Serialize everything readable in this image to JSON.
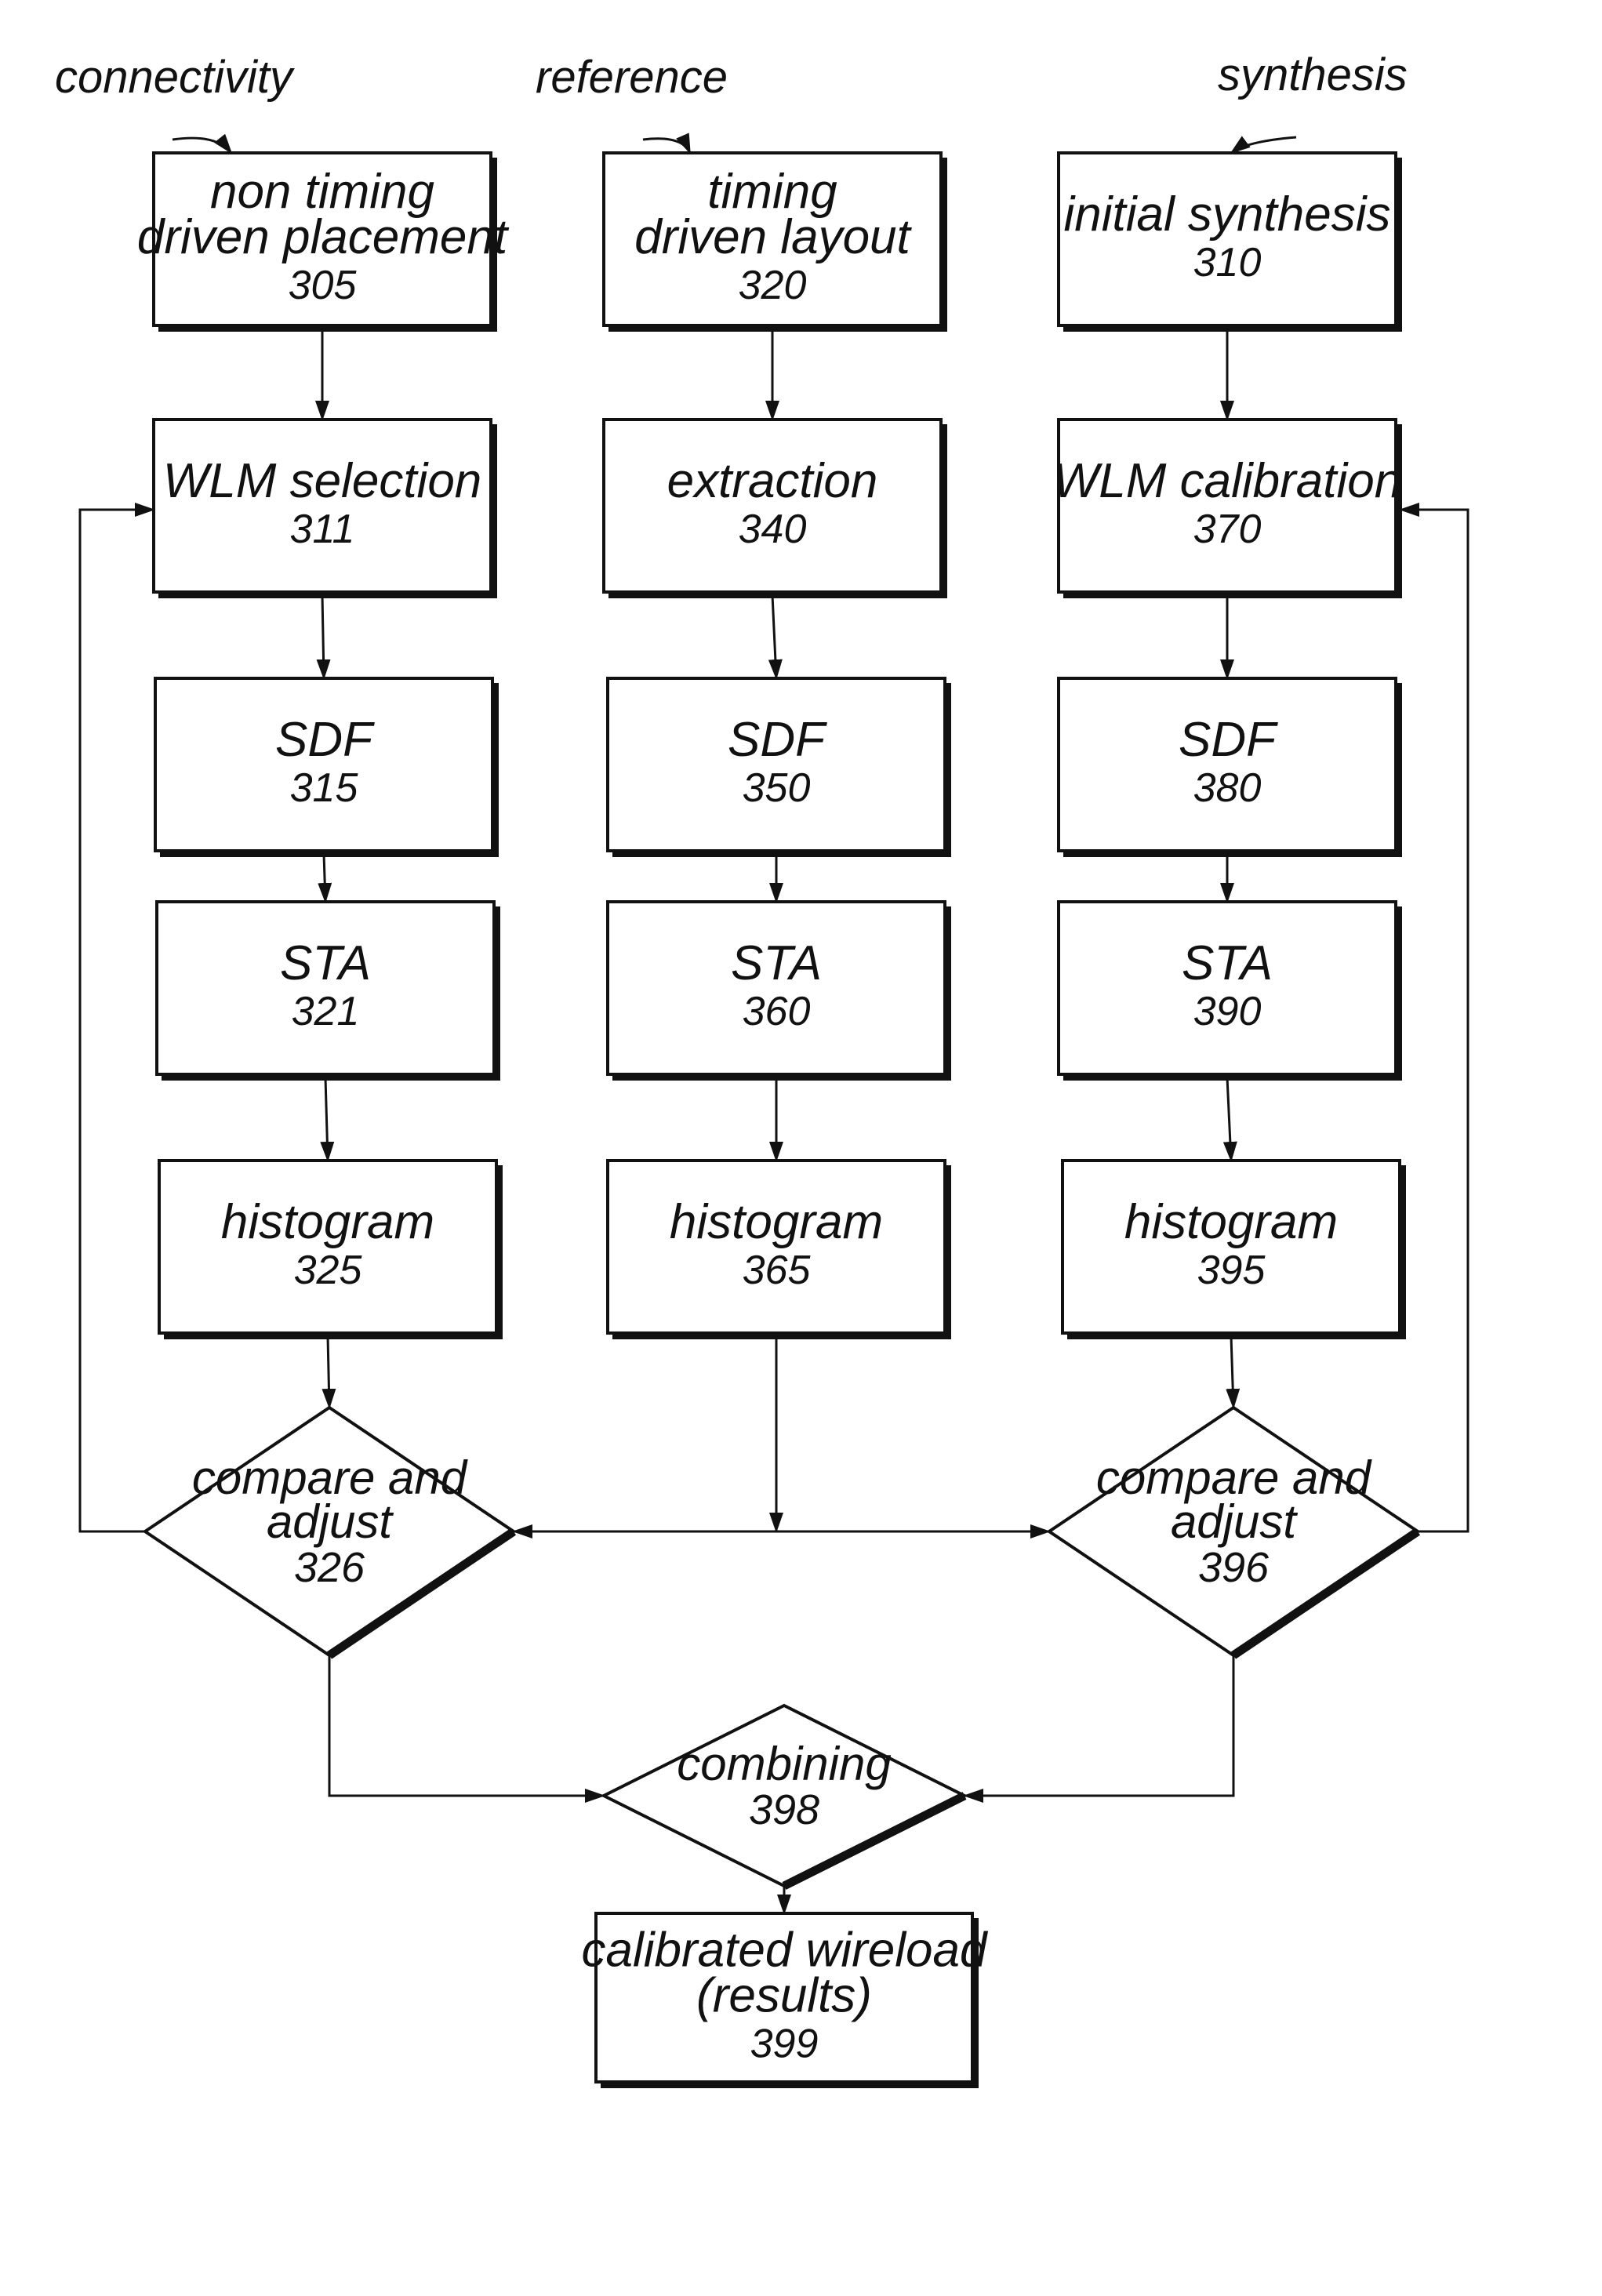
{
  "colors": {
    "ink": "#111111",
    "background": "#ffffff"
  },
  "inputs": [
    {
      "id": "connectivity",
      "label": "connectivity",
      "target": "305"
    },
    {
      "id": "reference",
      "label": "reference",
      "target": "320"
    },
    {
      "id": "synthesis",
      "label": "synthesis",
      "target": "310"
    }
  ],
  "nodes": [
    {
      "id": "305",
      "shape": "box",
      "lines": [
        "non timing",
        "driven placement"
      ],
      "ref": "305"
    },
    {
      "id": "320",
      "shape": "box",
      "lines": [
        "timing",
        "driven layout"
      ],
      "ref": "320"
    },
    {
      "id": "310",
      "shape": "box",
      "lines": [
        "initial synthesis"
      ],
      "ref": "310"
    },
    {
      "id": "311",
      "shape": "box",
      "lines": [
        "WLM selection"
      ],
      "ref": "311"
    },
    {
      "id": "340",
      "shape": "box",
      "lines": [
        "extraction"
      ],
      "ref": "340"
    },
    {
      "id": "370",
      "shape": "box",
      "lines": [
        "WLM calibration"
      ],
      "ref": "370"
    },
    {
      "id": "315",
      "shape": "box",
      "lines": [
        "SDF"
      ],
      "ref": "315"
    },
    {
      "id": "350",
      "shape": "box",
      "lines": [
        "SDF"
      ],
      "ref": "350"
    },
    {
      "id": "380",
      "shape": "box",
      "lines": [
        "SDF"
      ],
      "ref": "380"
    },
    {
      "id": "321",
      "shape": "box",
      "lines": [
        "STA"
      ],
      "ref": "321"
    },
    {
      "id": "360",
      "shape": "box",
      "lines": [
        "STA"
      ],
      "ref": "360"
    },
    {
      "id": "390",
      "shape": "box",
      "lines": [
        "STA"
      ],
      "ref": "390"
    },
    {
      "id": "325",
      "shape": "box",
      "lines": [
        "histogram"
      ],
      "ref": "325"
    },
    {
      "id": "365",
      "shape": "box",
      "lines": [
        "histogram"
      ],
      "ref": "365"
    },
    {
      "id": "395",
      "shape": "box",
      "lines": [
        "histogram"
      ],
      "ref": "395"
    },
    {
      "id": "326",
      "shape": "diamond",
      "lines": [
        "compare and",
        "adjust"
      ],
      "ref": "326"
    },
    {
      "id": "396",
      "shape": "diamond",
      "lines": [
        "compare and",
        "adjust"
      ],
      "ref": "396"
    },
    {
      "id": "398",
      "shape": "diamond",
      "lines": [
        "combining"
      ],
      "ref": "398"
    },
    {
      "id": "399",
      "shape": "box",
      "lines": [
        "calibrated wireload",
        "(results)"
      ],
      "ref": "399"
    }
  ],
  "edges": [
    {
      "from": "305",
      "to": "311"
    },
    {
      "from": "311",
      "to": "315"
    },
    {
      "from": "315",
      "to": "321"
    },
    {
      "from": "321",
      "to": "325"
    },
    {
      "from": "325",
      "to": "326"
    },
    {
      "from": "320",
      "to": "340"
    },
    {
      "from": "340",
      "to": "350"
    },
    {
      "from": "350",
      "to": "360"
    },
    {
      "from": "360",
      "to": "365"
    },
    {
      "from": "365",
      "to": "326"
    },
    {
      "from": "365",
      "to": "396"
    },
    {
      "from": "310",
      "to": "370"
    },
    {
      "from": "370",
      "to": "380"
    },
    {
      "from": "380",
      "to": "390"
    },
    {
      "from": "390",
      "to": "395"
    },
    {
      "from": "395",
      "to": "396"
    },
    {
      "from": "326",
      "to": "311",
      "kind": "feedback"
    },
    {
      "from": "396",
      "to": "370",
      "kind": "feedback"
    },
    {
      "from": "326",
      "to": "398"
    },
    {
      "from": "396",
      "to": "398"
    },
    {
      "from": "398",
      "to": "399"
    }
  ]
}
